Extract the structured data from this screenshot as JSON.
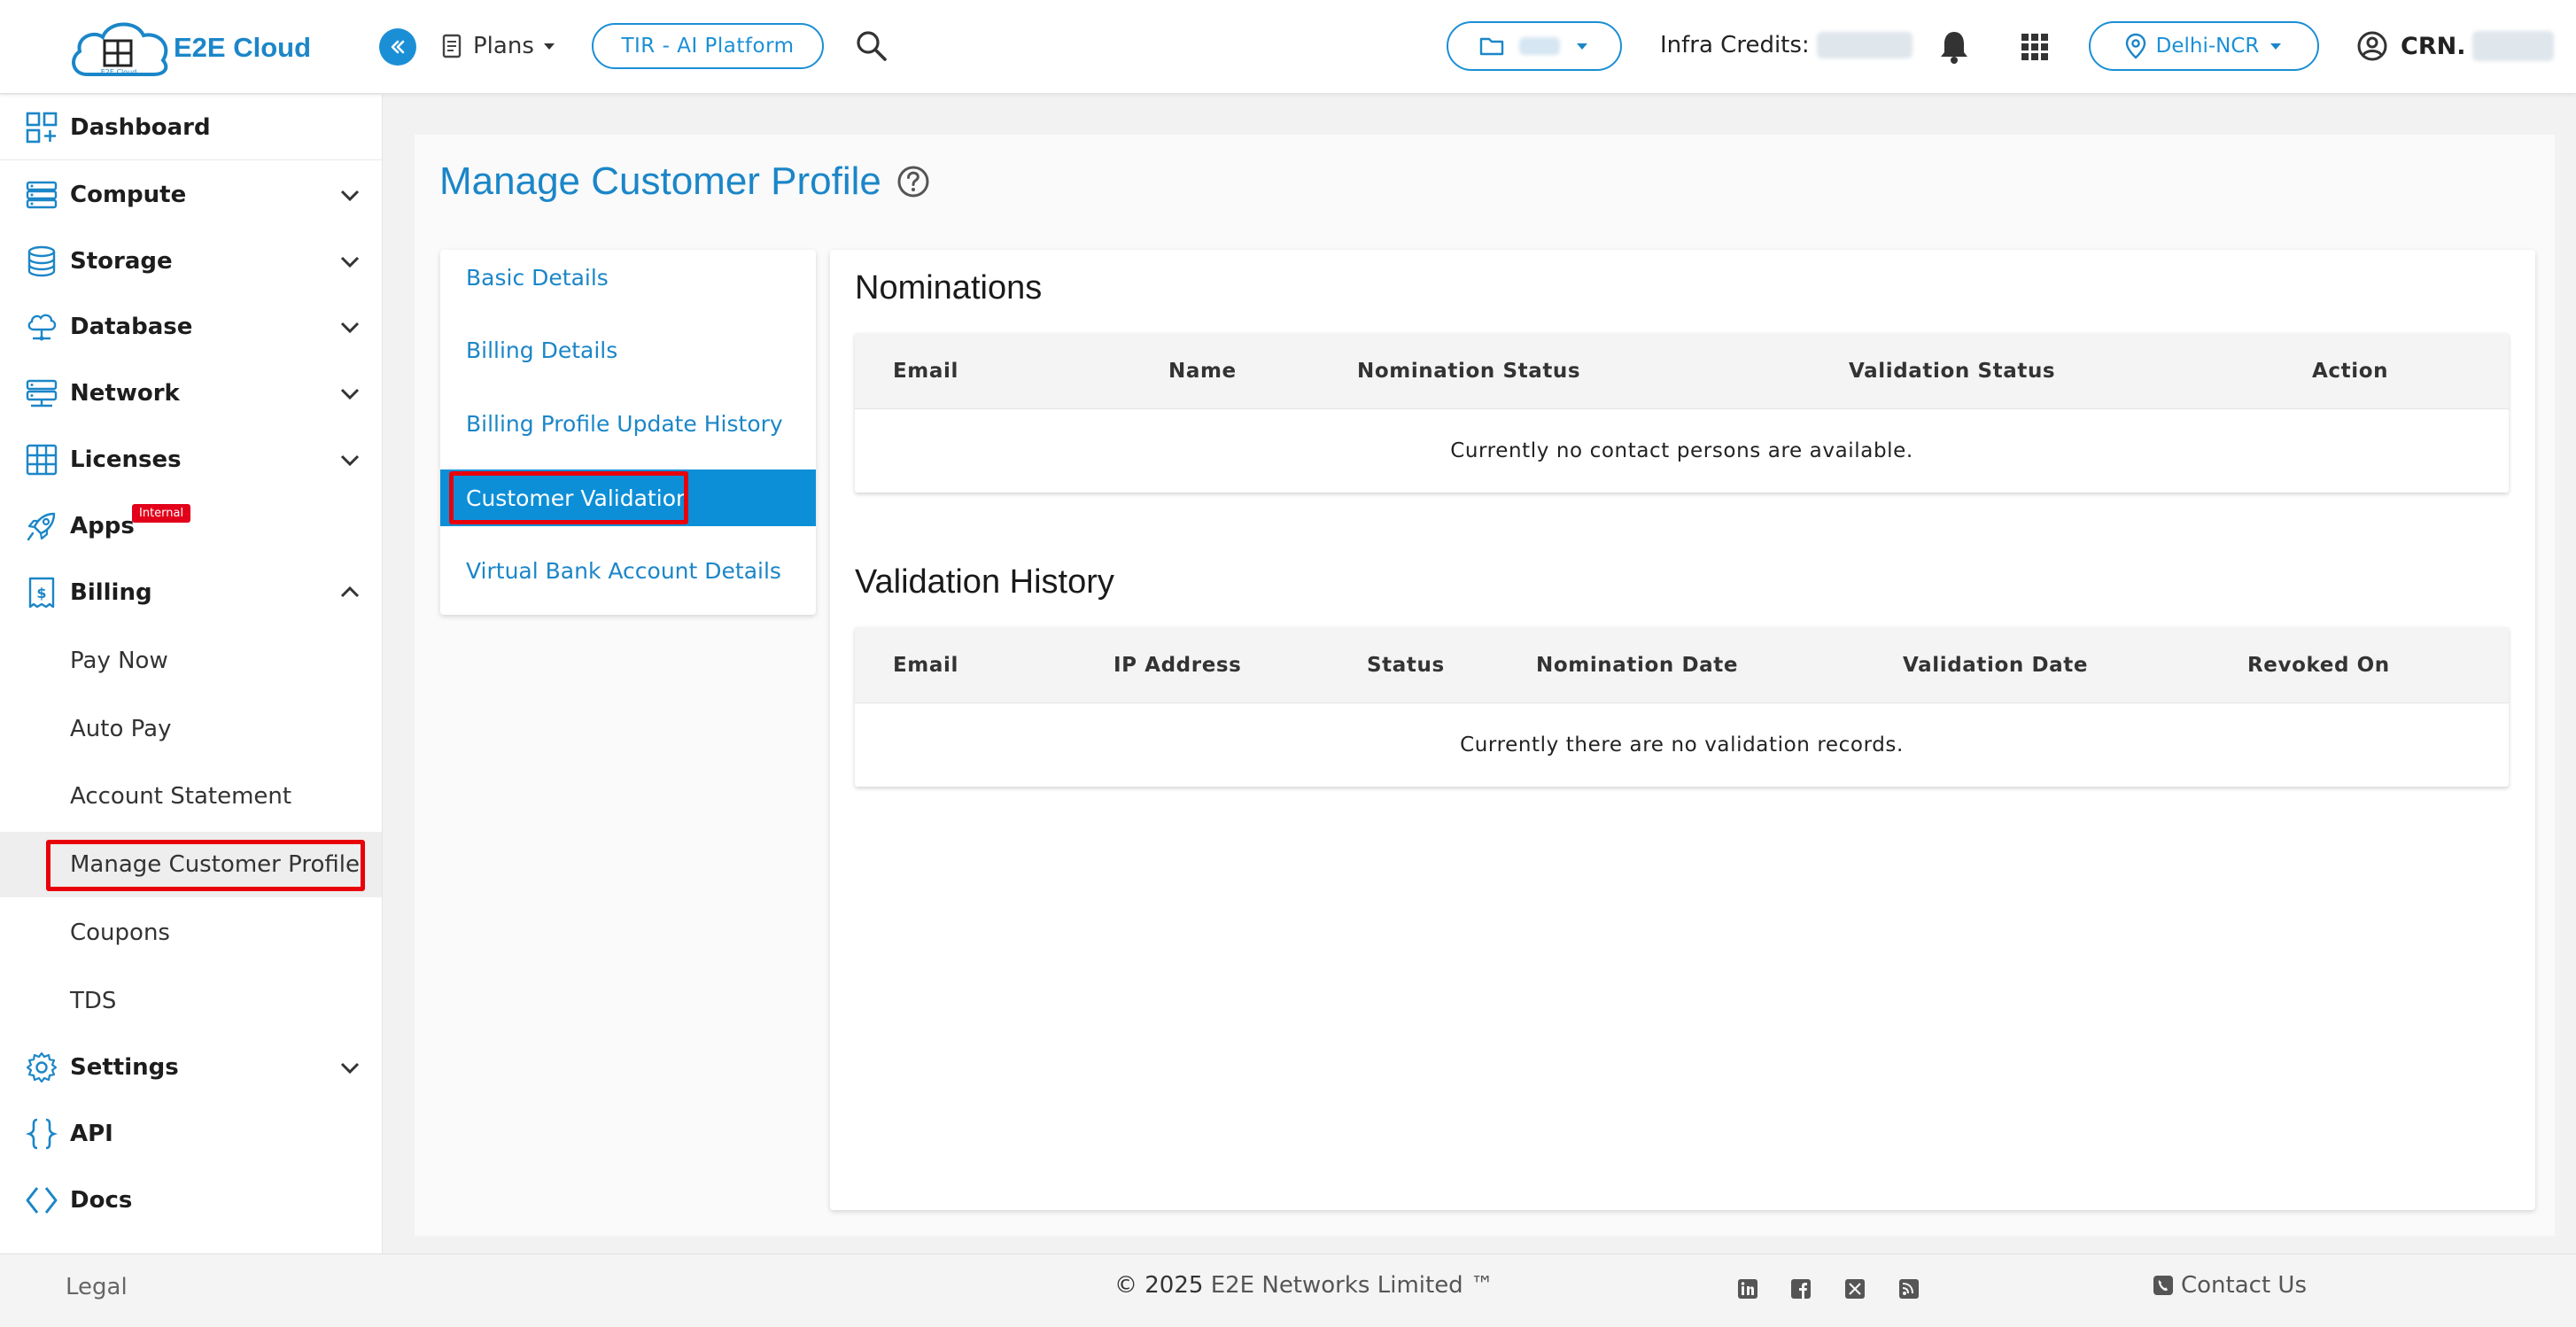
{
  "header": {
    "brand": "E2E Cloud",
    "logo_mark_text": "E2E Cloud",
    "plans_label": "Plans",
    "tir_label": "TIR - AI Platform",
    "credits_label": "Infra Credits:",
    "region_label": "Delhi-NCR",
    "crn_label": "CRN."
  },
  "sidebar": {
    "items": [
      {
        "label": "Dashboard"
      },
      {
        "label": "Compute"
      },
      {
        "label": "Storage"
      },
      {
        "label": "Database"
      },
      {
        "label": "Network"
      },
      {
        "label": "Licenses"
      },
      {
        "label": "Apps",
        "badge": "Internal"
      },
      {
        "label": "Billing"
      }
    ],
    "billing_sub": [
      {
        "label": "Pay Now"
      },
      {
        "label": "Auto Pay"
      },
      {
        "label": "Account Statement"
      },
      {
        "label": "Manage Customer Profile"
      },
      {
        "label": "Coupons"
      },
      {
        "label": "TDS"
      }
    ],
    "bottom_items": [
      {
        "label": "Settings"
      },
      {
        "label": "API"
      },
      {
        "label": "Docs"
      }
    ]
  },
  "page": {
    "title": "Manage Customer Profile"
  },
  "tabs": [
    {
      "label": "Basic Details"
    },
    {
      "label": "Billing Details"
    },
    {
      "label": "Billing Profile Update History"
    },
    {
      "label": "Customer Validation"
    },
    {
      "label": "Virtual Bank Account Details"
    }
  ],
  "nominations": {
    "title": "Nominations",
    "columns": [
      "Email",
      "Name",
      "Nomination Status",
      "Validation Status",
      "Action"
    ],
    "empty_text": "Currently no contact persons are available."
  },
  "validation_history": {
    "title": "Validation History",
    "columns": [
      "Email",
      "IP Address",
      "Status",
      "Nomination Date",
      "Validation Date",
      "Revoked On"
    ],
    "empty_text": "Currently there are no validation records."
  },
  "footer": {
    "legal": "Legal",
    "copyright_prefix": "© 2025",
    "copyright_brand": "E2E Networks Limited ™",
    "contact": "Contact Us"
  },
  "colors": {
    "accent": "#1b86c8",
    "active_tab": "#0d8fd8",
    "highlight_box": "#e8000b",
    "badge": "#e2001a"
  }
}
